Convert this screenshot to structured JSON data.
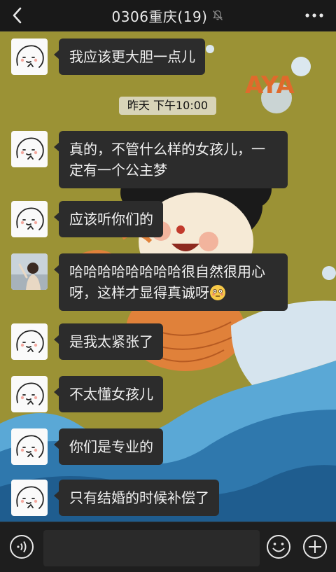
{
  "header": {
    "title": "0306重庆(19)",
    "back_icon": "chevron-left-icon",
    "mute_icon": "bell-off-icon",
    "more_icon": "more-horizontal-icon"
  },
  "background": {
    "art_text": "AYA"
  },
  "timestamp": "昨天 下午10:00",
  "messages": [
    {
      "sender": "sticker-avatar",
      "text": "我应该更大胆一点儿"
    },
    {
      "sender": "sticker-avatar",
      "text": "真的，不管什么样的女孩儿，一定有一个公主梦"
    },
    {
      "sender": "sticker-avatar",
      "text": "应该听你们的"
    },
    {
      "sender": "photo-avatar",
      "text": "哈哈哈哈哈哈哈哈很自然很用心呀，这样才显得真诚呀",
      "emoji": "flushed-face-emoji"
    },
    {
      "sender": "sticker-avatar",
      "text": "是我太紧张了"
    },
    {
      "sender": "sticker-avatar",
      "text": "不太懂女孩儿"
    },
    {
      "sender": "sticker-avatar",
      "text": "你们是专业的"
    },
    {
      "sender": "sticker-avatar",
      "text": "只有结婚的时候补偿了"
    }
  ],
  "input_bar": {
    "voice_icon": "voice-icon",
    "input_value": "",
    "emoji_icon": "smiley-icon",
    "plus_icon": "plus-circle-icon"
  },
  "colors": {
    "bar": "#191919",
    "bubble": "#2c2c2c",
    "wallpaper": "#9b9235",
    "timestamp_bg": "#d8d4b8"
  }
}
